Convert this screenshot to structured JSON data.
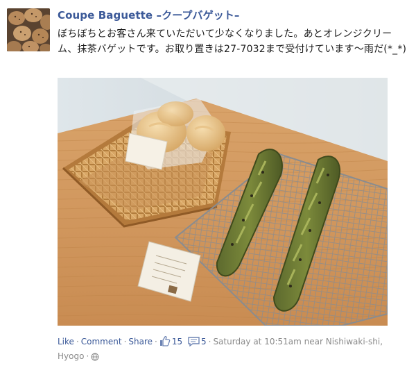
{
  "post": {
    "page_name": "Coupe Baguette –クープバゲット–",
    "message": "ぼちぼちとお客さん来ていただいて少なくなりました。あとオレンジクリーム、抹茶バゲットです。お取り置きは27-7032まで受付けています〜雨だ(*_*)",
    "photo_alt": "Bread rolls in a wicker basket and matcha baguettes on a cooling rack",
    "photo_card_label": "Coupe Baguette"
  },
  "actions": {
    "like": "Like",
    "comment": "Comment",
    "share": "Share",
    "likes_count": "15",
    "comments_count": "5",
    "timestamp": "Saturday at 10:51am near Nishiwaki-shi, Hyogo"
  },
  "colors": {
    "link": "#3b5998",
    "meta": "#8a8a8a"
  },
  "icons": [
    "thumbs-up-icon",
    "comment-bubble-icon",
    "globe-icon"
  ]
}
